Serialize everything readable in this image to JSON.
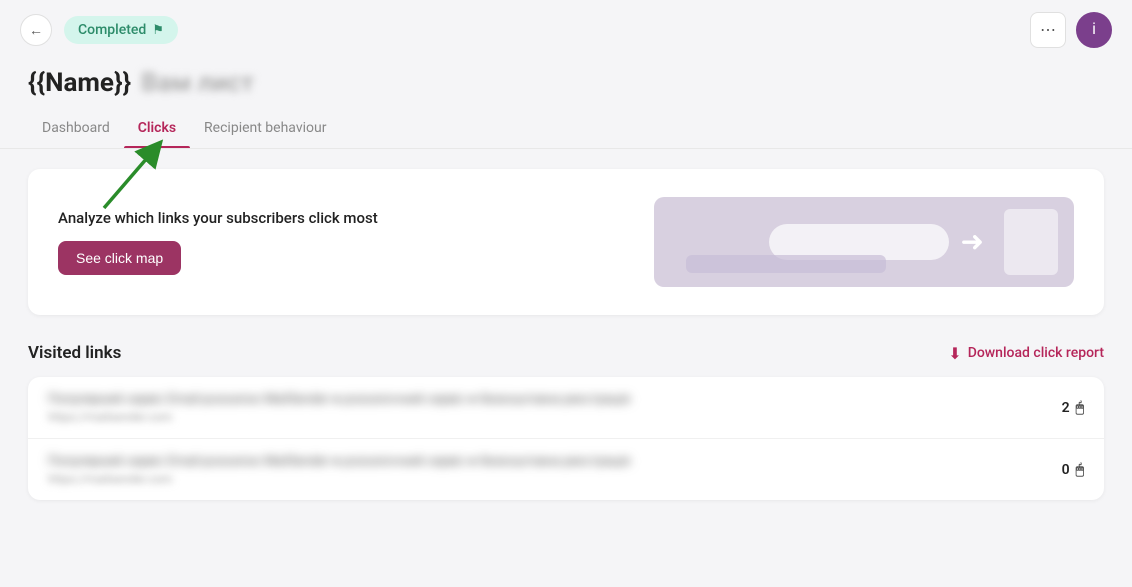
{
  "header": {
    "back_label": "←",
    "status_label": "Completed",
    "status_flag": "⚑",
    "menu_icon": "⋯",
    "info_icon": "i"
  },
  "page": {
    "title_main": "{{Name}}",
    "title_blurred": "Вам лист"
  },
  "tabs": [
    {
      "id": "dashboard",
      "label": "Dashboard",
      "active": false
    },
    {
      "id": "clicks",
      "label": "Clicks",
      "active": true
    },
    {
      "id": "recipient-behaviour",
      "label": "Recipient behaviour",
      "active": false
    }
  ],
  "promo_card": {
    "title": "Analyze which links your subscribers click most",
    "button_label": "See click map"
  },
  "visited_links": {
    "section_title": "Visited links",
    "download_label": "Download click report",
    "rows": [
      {
        "title_blurred": "Популярний сервіс Email-розсилок MailSender ● розсилочний сервіс ● безкоштовна реєстрація",
        "url_blurred": "https://mailsender.com",
        "count": "2"
      },
      {
        "title_blurred": "Популярний сервіс Email-розсилок MailSender ● розсилочний сервіс ● безкоштовна реєстрація",
        "url_blurred": "https://mailsender.com",
        "count": "0"
      }
    ]
  }
}
